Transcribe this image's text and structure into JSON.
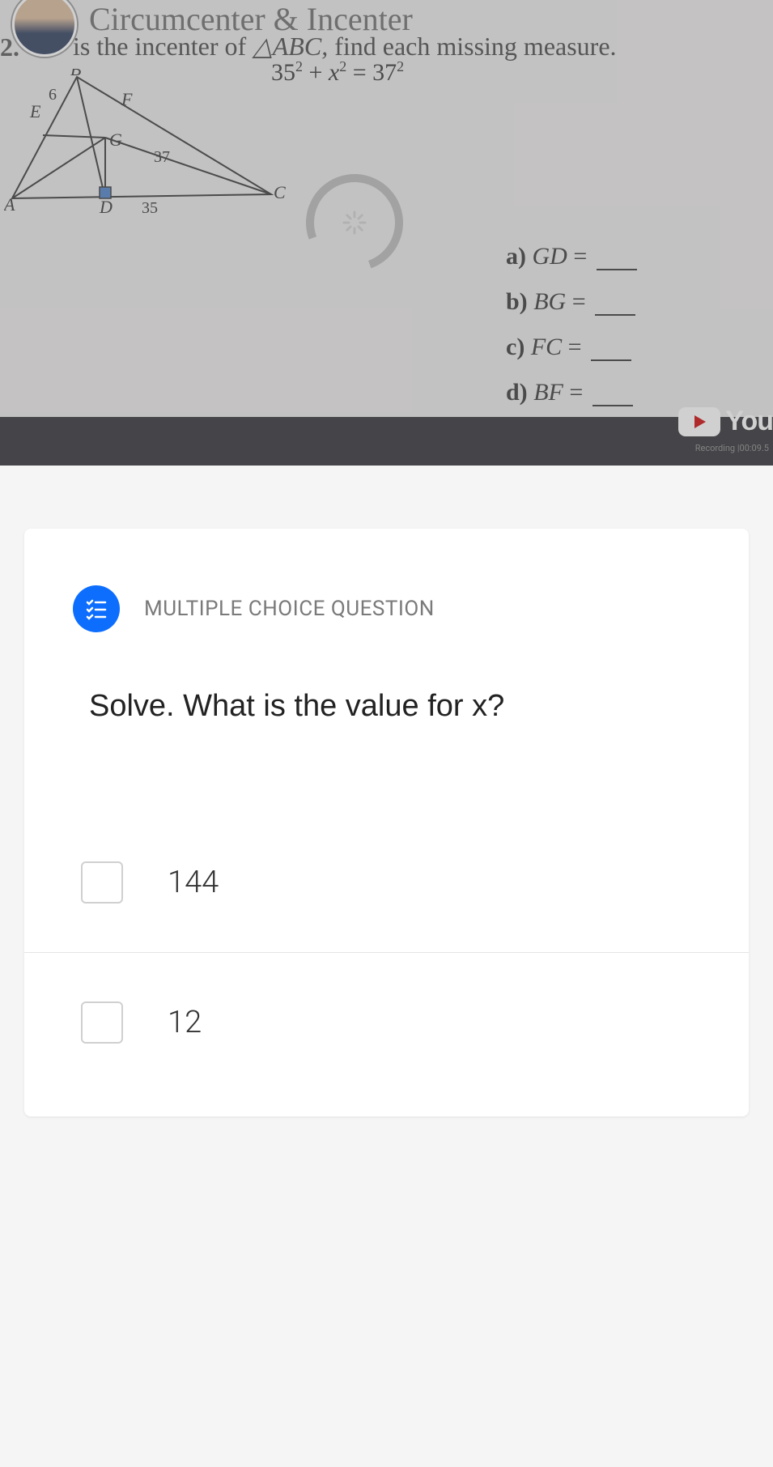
{
  "video": {
    "title": "Circumcenter & Incenter",
    "questionNumber": "2.",
    "subtitle_pre": "is the incenter of ",
    "subtitle_tri": "△ABC,",
    "subtitle_post": " find each missing measure.",
    "equation": {
      "lhs_base1": "35",
      "lhs_exp1": "2",
      "plus": " + ",
      "lhs_var": "x",
      "lhs_exp2": "2",
      "eq": " = ",
      "rhs_base": "37",
      "rhs_exp": "2"
    },
    "triangle_labels": {
      "A": "A",
      "B": "B",
      "C": "C",
      "D": "D",
      "E": "E",
      "F": "F",
      "G": "G",
      "six": "6",
      "thirtyseven": "37",
      "thirtyfive": "35"
    },
    "measures": [
      {
        "letter": "a)",
        "seg": "GD",
        "eq": "="
      },
      {
        "letter": "b)",
        "seg": "BG",
        "eq": "="
      },
      {
        "letter": "c)",
        "seg": "FC",
        "eq": "="
      },
      {
        "letter": "d)",
        "seg": "BF",
        "eq": "="
      }
    ],
    "youtubeText": "You",
    "recording": "Recording |00:09.5"
  },
  "quiz": {
    "typeLabel": "MULTIPLE CHOICE QUESTION",
    "question": "Solve. What is the value for x?",
    "options": [
      {
        "text": "144"
      },
      {
        "text": "12"
      }
    ]
  },
  "chart_data": {
    "type": "diagram",
    "description": "Triangle ABC with incenter G. D on AC, E on AB, F on BC. BE=6, GC=37, DC=35. Right angle at D. Equation 35^2 + x^2 = 37^2.",
    "given": {
      "BE": 6,
      "GC": 37,
      "DC": 35
    },
    "unknowns": [
      "GD",
      "BG",
      "FC",
      "BF"
    ],
    "equation": "35^2 + x^2 = 37^2"
  }
}
